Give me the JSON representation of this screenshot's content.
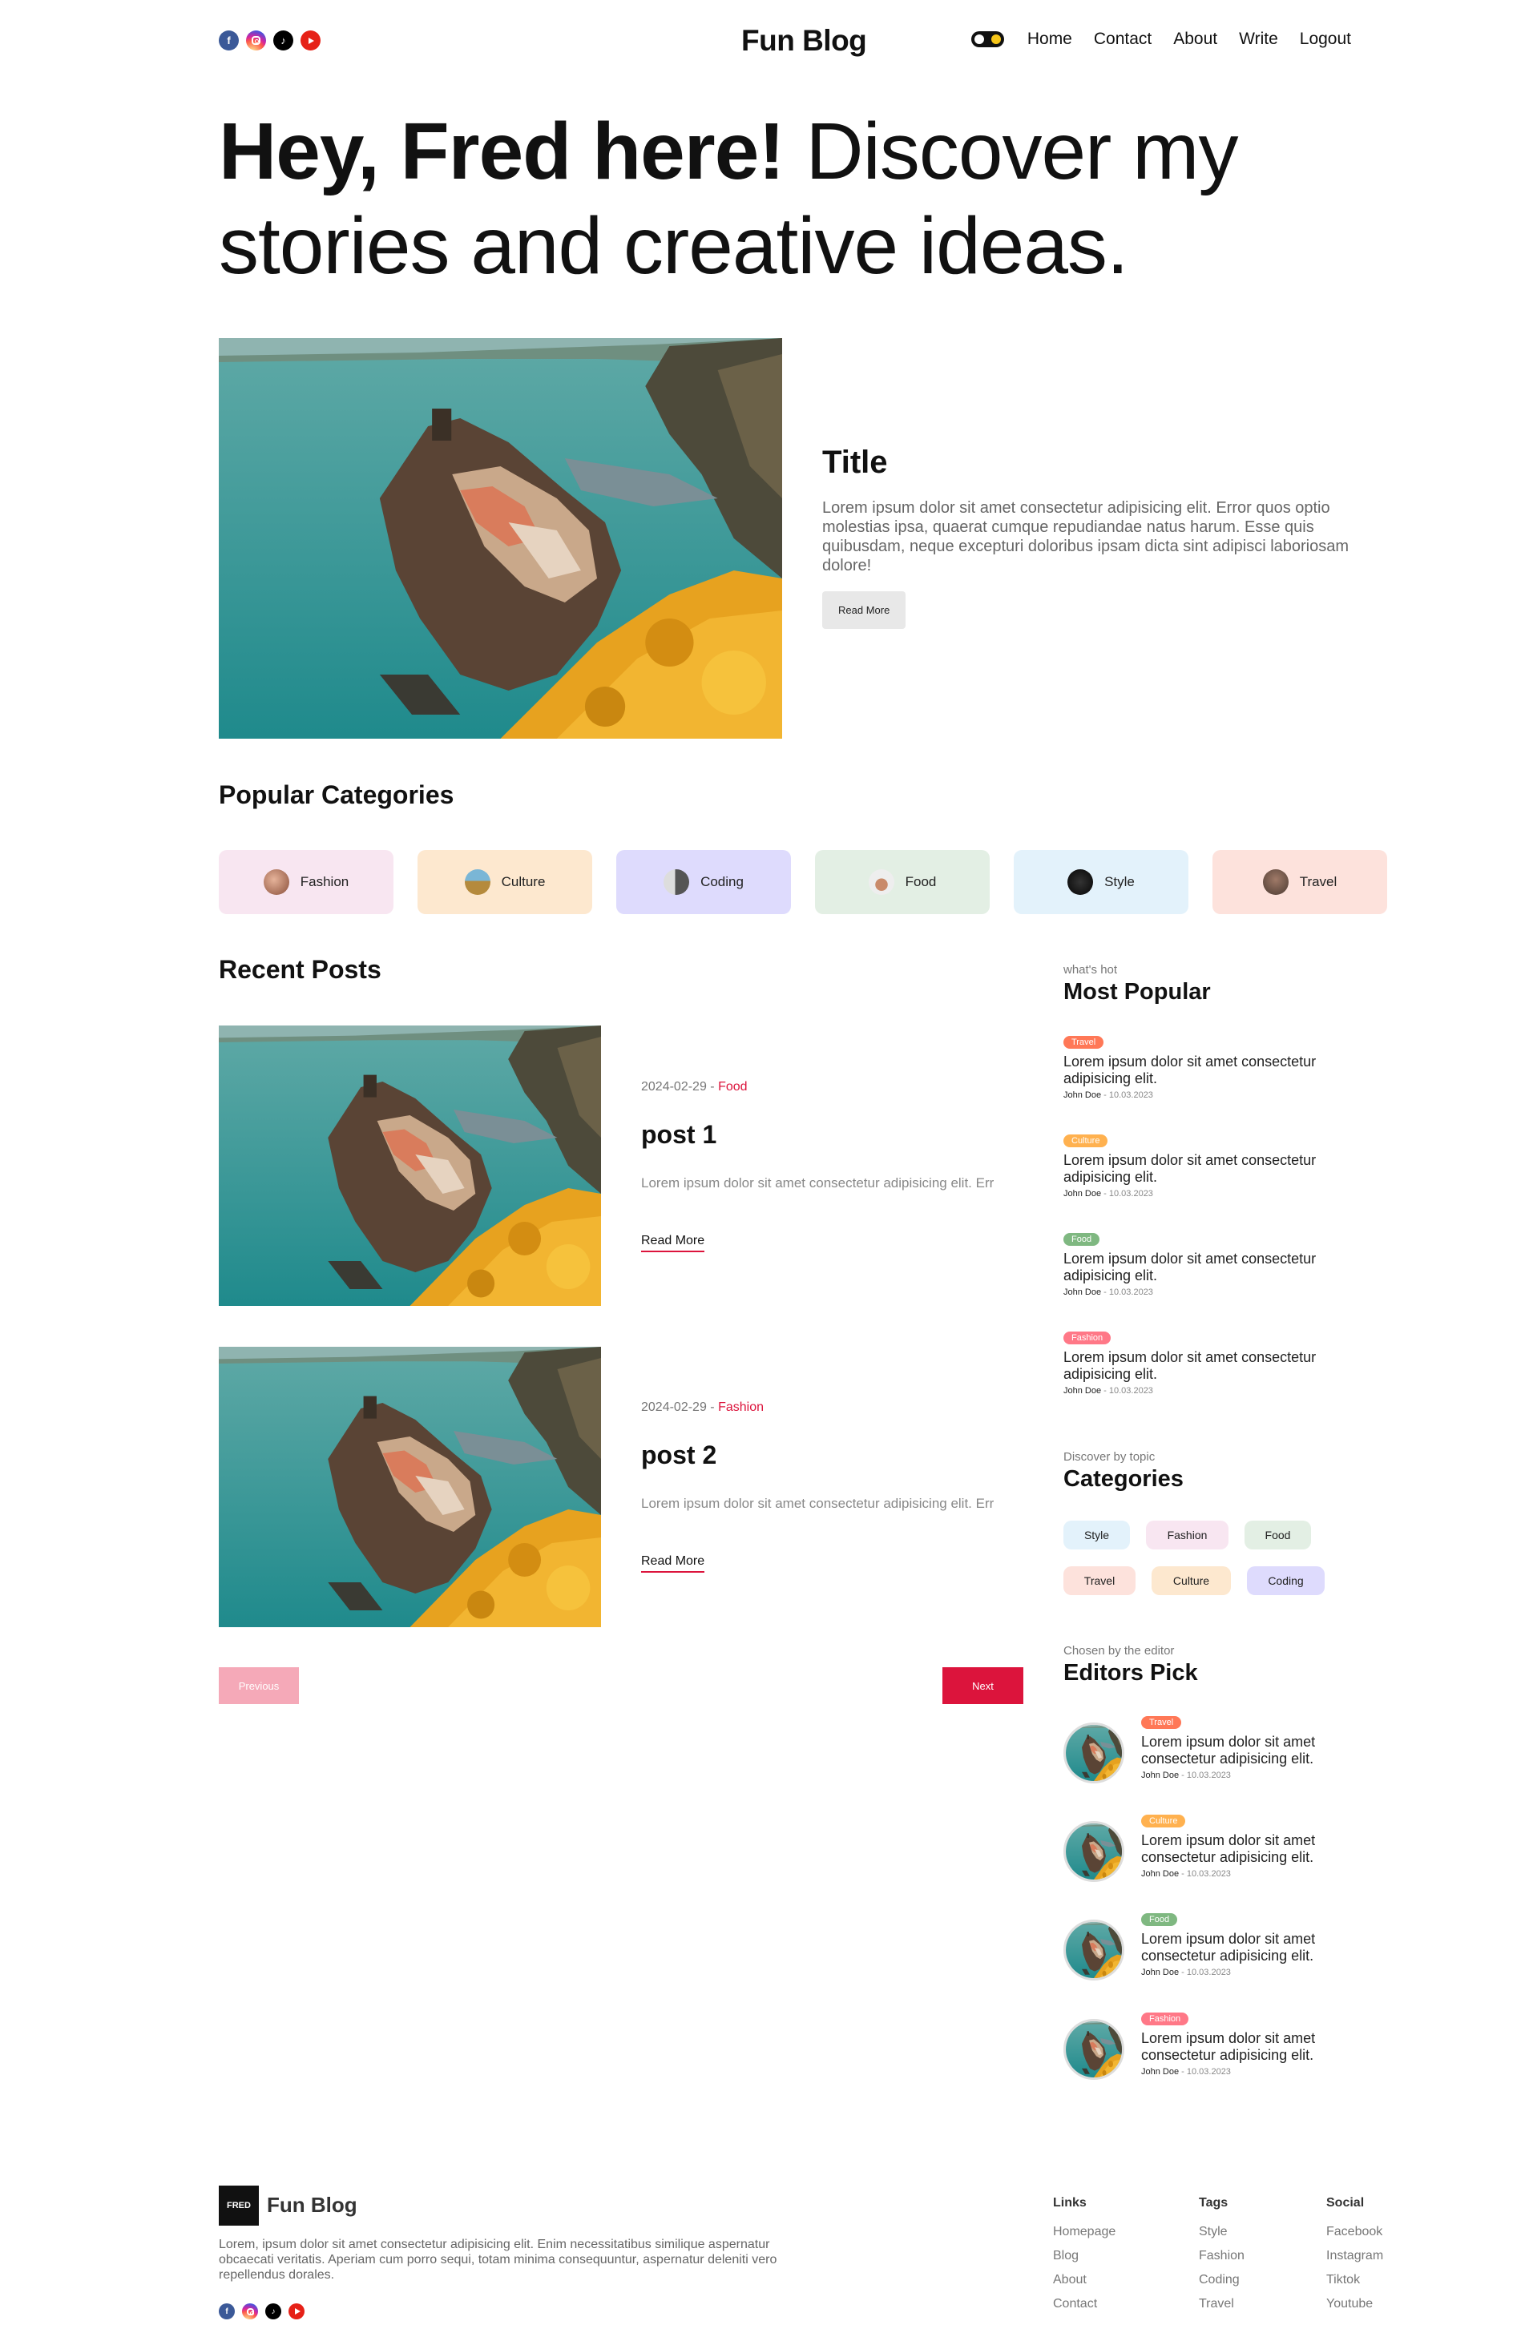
{
  "nav": {
    "logo": "Fun Blog",
    "links": [
      "Home",
      "Contact",
      "About",
      "Write",
      "Logout"
    ],
    "socials": [
      "facebook-icon",
      "instagram-icon",
      "tiktok-icon",
      "youtube-icon"
    ]
  },
  "hero": {
    "bold": "Hey, Fred here!",
    "light": " Discover my stories and creative ideas."
  },
  "featured": {
    "title": "Title",
    "desc": "Lorem ipsum dolor sit amet consectetur adipisicing elit. Error quos optio molestias ipsa, quaerat cumque repudiandae natus harum. Esse quis quibusdam, neque excepturi doloribus ipsam dicta sint adipisci laboriosam dolore!",
    "button": "Read More"
  },
  "popular_categories": {
    "title": "Popular Categories",
    "items": [
      {
        "label": "Fashion",
        "bg": "#f8e6f1"
      },
      {
        "label": "Culture",
        "bg": "#fde8cf"
      },
      {
        "label": "Coding",
        "bg": "#dedbfd"
      },
      {
        "label": "Food",
        "bg": "#e3efe4"
      },
      {
        "label": "Style",
        "bg": "#e3f2fb"
      },
      {
        "label": "Travel",
        "bg": "#fde2dc"
      }
    ]
  },
  "recent": {
    "title": "Recent Posts",
    "posts": [
      {
        "date": "2024-02-29 - ",
        "category": "Food",
        "title": "post 1",
        "desc": "Lorem ipsum dolor sit amet consectetur adipisicing elit. Err",
        "more": "Read More"
      },
      {
        "date": "2024-02-29 - ",
        "category": "Fashion",
        "title": "post 2",
        "desc": "Lorem ipsum dolor sit amet consectetur adipisicing elit. Err",
        "more": "Read More"
      }
    ],
    "prev": "Previous",
    "next": "Next"
  },
  "most_popular": {
    "subtitle": "what's hot",
    "title": "Most Popular",
    "items": [
      {
        "tag": "Travel",
        "color": "#ff7857",
        "text": "Lorem ipsum dolor sit amet consectetur adipisicing elit.",
        "author": "John Doe",
        "date": " - 10.03.2023"
      },
      {
        "tag": "Culture",
        "color": "#ffb14f",
        "text": "Lorem ipsum dolor sit amet consectetur adipisicing elit.",
        "author": "John Doe",
        "date": " - 10.03.2023"
      },
      {
        "tag": "Food",
        "color": "#7fb881",
        "text": "Lorem ipsum dolor sit amet consectetur adipisicing elit.",
        "author": "John Doe",
        "date": " - 10.03.2023"
      },
      {
        "tag": "Fashion",
        "color": "#ff7887",
        "text": "Lorem ipsum dolor sit amet consectetur adipisicing elit.",
        "author": "John Doe",
        "date": " - 10.03.2023"
      }
    ]
  },
  "side_categories": {
    "subtitle": "Discover by topic",
    "title": "Categories",
    "chips": [
      {
        "label": "Style",
        "bg": "#e3f2fb"
      },
      {
        "label": "Fashion",
        "bg": "#f8e6f1"
      },
      {
        "label": "Food",
        "bg": "#e3efe4"
      },
      {
        "label": "Travel",
        "bg": "#fde2dc"
      },
      {
        "label": "Culture",
        "bg": "#fde8cf"
      },
      {
        "label": "Coding",
        "bg": "#dedbfd"
      }
    ]
  },
  "editors_pick": {
    "subtitle": "Chosen by the editor",
    "title": "Editors Pick",
    "items": [
      {
        "tag": "Travel",
        "color": "#ff7857",
        "text": "Lorem ipsum dolor sit amet consectetur adipisicing elit.",
        "author": "John Doe",
        "date": " - 10.03.2023"
      },
      {
        "tag": "Culture",
        "color": "#ffb14f",
        "text": "Lorem ipsum dolor sit amet consectetur adipisicing elit.",
        "author": "John Doe",
        "date": " - 10.03.2023"
      },
      {
        "tag": "Food",
        "color": "#7fb881",
        "text": "Lorem ipsum dolor sit amet consectetur adipisicing elit.",
        "author": "John Doe",
        "date": " - 10.03.2023"
      },
      {
        "tag": "Fashion",
        "color": "#ff7887",
        "text": "Lorem ipsum dolor sit amet consectetur adipisicing elit.",
        "author": "John Doe",
        "date": " - 10.03.2023"
      }
    ]
  },
  "footer": {
    "logo_text": "FRED",
    "name": "Fun Blog",
    "desc": "Lorem, ipsum dolor sit amet consectetur adipisicing elit. Enim necessitatibus similique aspernatur obcaecati veritatis. Aperiam cum porro sequi, totam minima consequuntur, aspernatur deleniti vero repellendus dorales.",
    "columns": [
      {
        "heading": "Links",
        "items": [
          "Homepage",
          "Blog",
          "About",
          "Contact"
        ]
      },
      {
        "heading": "Tags",
        "items": [
          "Style",
          "Fashion",
          "Coding",
          "Travel"
        ]
      },
      {
        "heading": "Social",
        "items": [
          "Facebook",
          "Instagram",
          "Tiktok",
          "Youtube"
        ]
      }
    ]
  }
}
